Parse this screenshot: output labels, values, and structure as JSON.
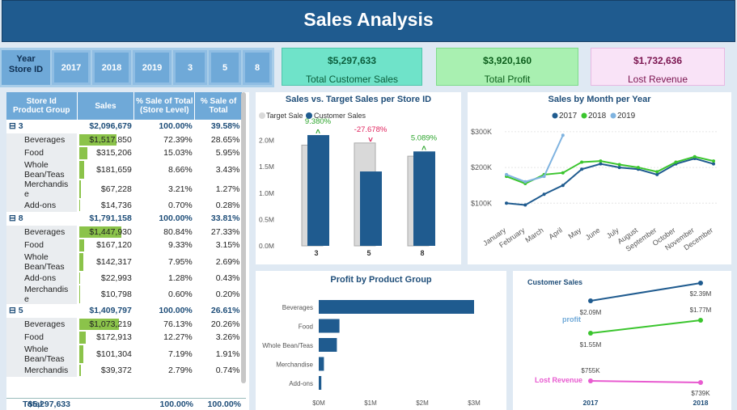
{
  "header": {
    "title": "Sales Analysis"
  },
  "slicer": {
    "label": "Year\nStore ID",
    "buttons": [
      "2017",
      "2018",
      "2019",
      "3",
      "5",
      "8"
    ]
  },
  "kpis": [
    {
      "value": "$5,297,633",
      "label": "Total Customer Sales",
      "bg": "#6fe3c9",
      "border": "#4fc6ac",
      "color": "#0a5d3b"
    },
    {
      "value": "$3,920,160",
      "label": "Total Profit",
      "bg": "#a9f0b1",
      "border": "#7fdc8a",
      "color": "#0a5d1a"
    },
    {
      "value": "$1,732,636",
      "label": "Lost Revenue",
      "bg": "#f9e3f7",
      "border": "#e8b9e3",
      "color": "#7b1550"
    }
  ],
  "table": {
    "headers": [
      "Store Id\nProduct Group",
      "Sales",
      "% Sale of Total\n(Store Level)",
      "% Sale of\nTotal"
    ],
    "rows": [
      {
        "type": "grp",
        "name": "⊟ 3",
        "sales": "$2,096,679",
        "pct_store": "100.00%",
        "pct_total": "39.58%"
      },
      {
        "type": "sub",
        "name": "Beverages",
        "sales": "$1,517,850",
        "pct_store": "72.39%",
        "pct_total": "28.65%",
        "bar": 0.7239
      },
      {
        "type": "sub",
        "name": "Food",
        "sales": "$315,206",
        "pct_store": "15.03%",
        "pct_total": "5.95%",
        "bar": 0.1503
      },
      {
        "type": "sub",
        "name": "Whole\nBean/Teas",
        "sales": "$181,659",
        "pct_store": "8.66%",
        "pct_total": "3.43%",
        "bar": 0.0866
      },
      {
        "type": "sub",
        "name": "Merchandis\ne",
        "sales": "$67,228",
        "pct_store": "3.21%",
        "pct_total": "1.27%",
        "bar": 0.0321
      },
      {
        "type": "sub",
        "name": "Add-ons",
        "sales": "$14,736",
        "pct_store": "0.70%",
        "pct_total": "0.28%",
        "bar": 0.007
      },
      {
        "type": "grp",
        "name": "⊟ 8",
        "sales": "$1,791,158",
        "pct_store": "100.00%",
        "pct_total": "33.81%"
      },
      {
        "type": "sub",
        "name": "Beverages",
        "sales": "$1,447,930",
        "pct_store": "80.84%",
        "pct_total": "27.33%",
        "bar": 0.8084
      },
      {
        "type": "sub",
        "name": "Food",
        "sales": "$167,120",
        "pct_store": "9.33%",
        "pct_total": "3.15%",
        "bar": 0.0933
      },
      {
        "type": "sub",
        "name": "Whole\nBean/Teas",
        "sales": "$142,317",
        "pct_store": "7.95%",
        "pct_total": "2.69%",
        "bar": 0.0795
      },
      {
        "type": "sub",
        "name": "Add-ons",
        "sales": "$22,993",
        "pct_store": "1.28%",
        "pct_total": "0.43%",
        "bar": 0.0128
      },
      {
        "type": "sub",
        "name": "Merchandis\ne",
        "sales": "$10,798",
        "pct_store": "0.60%",
        "pct_total": "0.20%",
        "bar": 0.006
      },
      {
        "type": "grp",
        "name": "⊟ 5",
        "sales": "$1,409,797",
        "pct_store": "100.00%",
        "pct_total": "26.61%"
      },
      {
        "type": "sub",
        "name": "Beverages",
        "sales": "$1,073,219",
        "pct_store": "76.13%",
        "pct_total": "20.26%",
        "bar": 0.7613
      },
      {
        "type": "sub",
        "name": "Food",
        "sales": "$172,913",
        "pct_store": "12.27%",
        "pct_total": "3.26%",
        "bar": 0.1227
      },
      {
        "type": "sub",
        "name": "Whole\nBean/Teas",
        "sales": "$101,304",
        "pct_store": "7.19%",
        "pct_total": "1.91%",
        "bar": 0.0719
      },
      {
        "type": "sub",
        "name": "Merchandis",
        "sales": "$39,372",
        "pct_store": "2.79%",
        "pct_total": "0.74%",
        "bar": 0.0279
      }
    ],
    "total": {
      "name": "Total",
      "sales": "$5,297,633",
      "pct_store": "100.00%",
      "pct_total": "100.00%"
    }
  },
  "chart_data": [
    {
      "type": "bar",
      "title": "Sales vs. Target Sales per Store ID",
      "legend": [
        "Target Sale",
        "Customer Sales"
      ],
      "categories": [
        "3",
        "5",
        "8"
      ],
      "series": [
        {
          "name": "Target Sale",
          "values": [
            1.91,
            1.95,
            1.7
          ],
          "color": "#d9d9d9"
        },
        {
          "name": "Customer Sales",
          "values": [
            2.1,
            1.41,
            1.79
          ],
          "color": "#1f5b8f"
        }
      ],
      "annotations": [
        "9.380%",
        "-27.678%",
        "5.089%"
      ],
      "annotation_colors": [
        "#2ea52e",
        "#e0245e",
        "#2ea52e"
      ],
      "yticks": [
        "0.0M",
        "0.5M",
        "1.0M",
        "1.5M",
        "2.0M"
      ],
      "ylim": [
        0,
        2.3
      ]
    },
    {
      "type": "line",
      "title": "Sales by Month per Year",
      "x": [
        "January",
        "February",
        "March",
        "April",
        "May",
        "June",
        "July",
        "August",
        "September",
        "October",
        "November",
        "December"
      ],
      "series": [
        {
          "name": "2017",
          "color": "#1f5b8f",
          "values": [
            100,
            95,
            125,
            150,
            195,
            210,
            200,
            195,
            180,
            210,
            225,
            210
          ]
        },
        {
          "name": "2018",
          "color": "#3bc52e",
          "values": [
            175,
            155,
            180,
            185,
            215,
            218,
            208,
            200,
            188,
            215,
            230,
            218
          ]
        },
        {
          "name": "2019",
          "color": "#7fb3e0",
          "values": [
            180,
            160,
            175,
            290
          ]
        }
      ],
      "yticks": [
        "$100K",
        "$200K",
        "$300K"
      ],
      "ylim": [
        60,
        320
      ]
    },
    {
      "type": "bar",
      "title": "Profit by Product Group",
      "categories": [
        "Beverages",
        "Food",
        "Whole Bean/Teas",
        "Merchandise",
        "Add-ons"
      ],
      "values": [
        3.0,
        0.4,
        0.35,
        0.1,
        0.05
      ],
      "xticks": [
        "$0M",
        "$1M",
        "$2M",
        "$3M"
      ],
      "xlim": [
        0,
        3.0
      ],
      "color": "#1f5b8f"
    },
    {
      "type": "line",
      "title": "Customer Sales",
      "x": [
        "2017",
        "2018"
      ],
      "series": [
        {
          "name": "Customer Sales",
          "color": "#1f5b8f",
          "values": [
            2.09,
            2.39
          ],
          "labels": [
            "$2.09M",
            "$2.39M"
          ]
        },
        {
          "name": "profit",
          "color": "#3bc52e",
          "values": [
            1.55,
            1.77
          ],
          "labels": [
            "$1.55M",
            "$1.77M"
          ]
        },
        {
          "name": "Lost Revenue",
          "color": "#e85bd0",
          "values": [
            0.755,
            0.739
          ],
          "labels": [
            "$755K",
            "$739K"
          ]
        }
      ]
    }
  ]
}
